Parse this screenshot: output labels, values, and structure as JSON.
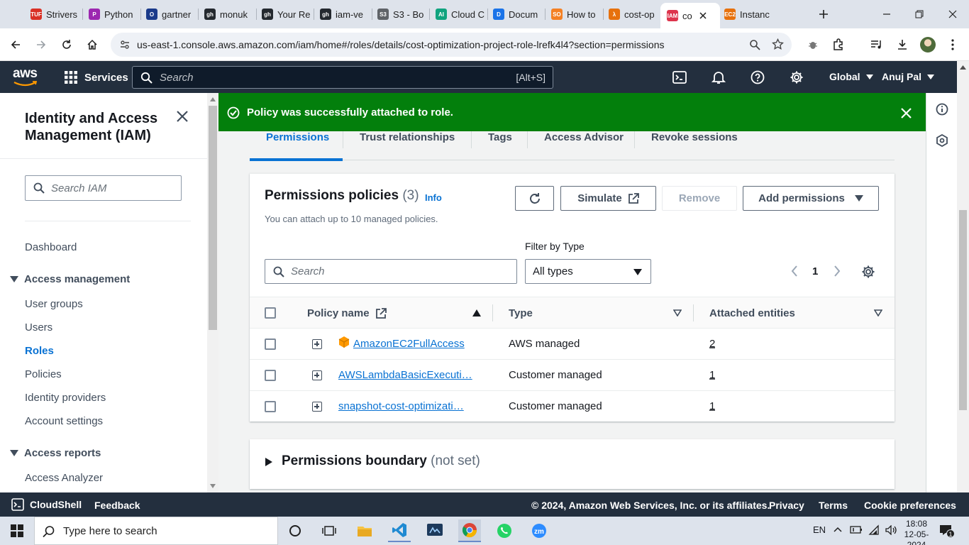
{
  "browser": {
    "tabs": [
      {
        "title": "Strivers",
        "fav_color": "#d93025",
        "fav_text": "TUF"
      },
      {
        "title": "Python",
        "fav_color": "#9c27b0",
        "fav_text": "P"
      },
      {
        "title": "gartner",
        "fav_color": "#1a3a8a",
        "fav_text": "O"
      },
      {
        "title": "monuk",
        "fav_color": "#24292f",
        "fav_text": "gh"
      },
      {
        "title": "Your Re",
        "fav_color": "#24292f",
        "fav_text": "gh"
      },
      {
        "title": "iam-ve",
        "fav_color": "#24292f",
        "fav_text": "gh"
      },
      {
        "title": "S3 - Bo",
        "fav_color": "#5f6368",
        "fav_text": "S3"
      },
      {
        "title": "Cloud C",
        "fav_color": "#10a37f",
        "fav_text": "AI"
      },
      {
        "title": "Docum",
        "fav_color": "#1a73e8",
        "fav_text": "D"
      },
      {
        "title": "How to",
        "fav_color": "#f48024",
        "fav_text": "SO"
      },
      {
        "title": "cost-op",
        "fav_color": "#e7710d",
        "fav_text": "λ"
      },
      {
        "title": "co",
        "fav_color": "#dd344c",
        "fav_text": "IAM"
      },
      {
        "title": "Instanc",
        "fav_color": "#e7710d",
        "fav_text": "EC2"
      }
    ],
    "active_tab_index": 11,
    "url": "us-east-1.console.aws.amazon.com/iam/home#/roles/details/cost-optimization-project-role-lrefk4l4?section=permissions"
  },
  "aws_header": {
    "logo": "aws",
    "services_label": "Services",
    "search_placeholder": "Search",
    "search_shortcut": "[Alt+S]",
    "region": "Global",
    "user": "Anuj Pal"
  },
  "sidebar": {
    "title": "Identity and Access Management (IAM)",
    "search_placeholder": "Search IAM",
    "dashboard": "Dashboard",
    "access_management": {
      "label": "Access management",
      "items": [
        "User groups",
        "Users",
        "Roles",
        "Policies",
        "Identity providers",
        "Account settings"
      ],
      "active": "Roles"
    },
    "access_reports": {
      "label": "Access reports",
      "items": [
        "Access Analyzer"
      ]
    }
  },
  "flash": {
    "message": "Policy was successfully attached to role.",
    "color": "#037f0c"
  },
  "tabs": [
    "Permissions",
    "Trust relationships",
    "Tags",
    "Access Advisor",
    "Revoke sessions"
  ],
  "active_tab": "Permissions",
  "permissions_policies": {
    "title": "Permissions policies",
    "count": "(3)",
    "info": "Info",
    "description": "You can attach up to 10 managed policies.",
    "buttons": {
      "simulate": "Simulate",
      "remove": "Remove",
      "add_permissions": "Add permissions"
    },
    "search_placeholder": "Search",
    "filter_label": "Filter by Type",
    "filter_value": "All types",
    "page": "1",
    "columns": [
      "Policy name",
      "Type",
      "Attached entities"
    ],
    "rows": [
      {
        "name": "AmazonEC2FullAccess",
        "type": "AWS managed",
        "entities": "2"
      },
      {
        "name": "AWSLambdaBasicExecuti…",
        "type": "Customer managed",
        "entities": "1"
      },
      {
        "name": "snapshot-cost-optimizati…",
        "type": "Customer managed",
        "entities": "1"
      }
    ]
  },
  "permissions_boundary": {
    "title": "Permissions boundary",
    "status": "(not set)"
  },
  "footer": {
    "cloudshell": "CloudShell",
    "feedback": "Feedback",
    "copyright": "© 2024, Amazon Web Services, Inc. or its affiliates.",
    "privacy": "Privacy",
    "terms": "Terms",
    "cookies": "Cookie preferences"
  },
  "taskbar": {
    "search_placeholder": "Type here to search",
    "language": "EN",
    "time": "18:08",
    "date": "12-05-2024",
    "notifications": "1"
  },
  "colors": {
    "aws_nav": "#232f3e",
    "link": "#0972d3",
    "success": "#037f0c",
    "aws_orange": "#ff9900"
  }
}
